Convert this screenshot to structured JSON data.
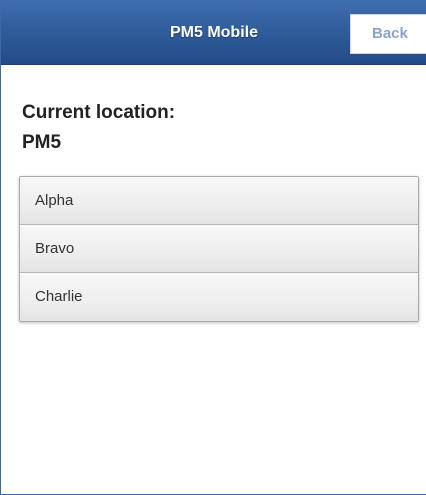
{
  "header": {
    "title": "PM5 Mobile",
    "back_label": "Back"
  },
  "location": {
    "label": "Current location:",
    "value": "PM5"
  },
  "list": {
    "items": [
      {
        "label": "Alpha"
      },
      {
        "label": "Bravo"
      },
      {
        "label": "Charlie"
      }
    ]
  },
  "colors": {
    "header_bg": "#2e5a99",
    "header_text": "#ffffff",
    "back_text": "#8aa4c8",
    "list_bg": "#eeeeee"
  }
}
